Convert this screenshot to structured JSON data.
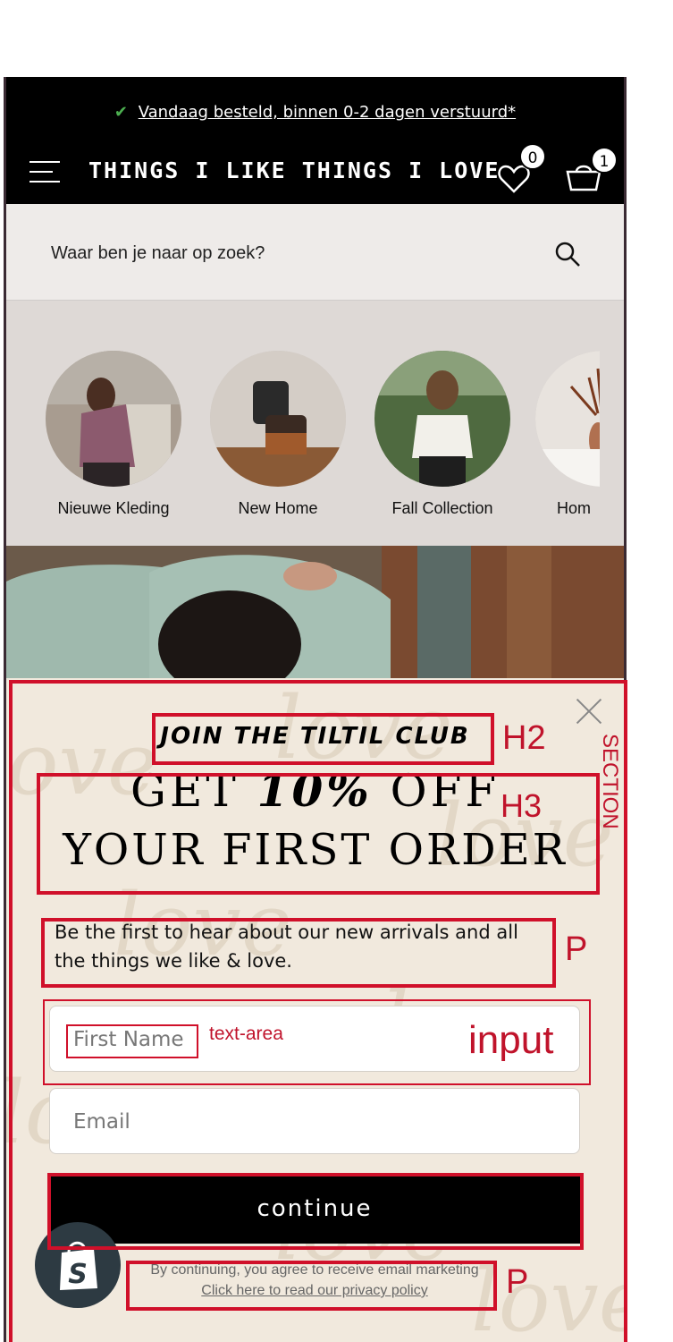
{
  "announcement": {
    "check": "✔",
    "text": "Vandaag besteld, binnen 0-2 dagen verstuurd*"
  },
  "header": {
    "logo": "THINGS I LIKE THINGS I LOVE",
    "wishlist_count": "0",
    "cart_count": "1"
  },
  "search": {
    "placeholder": "Waar ben je naar op zoek?"
  },
  "categories": [
    {
      "label": "Nieuwe Kleding"
    },
    {
      "label": "New Home"
    },
    {
      "label": "Fall Collection"
    },
    {
      "label": "Hom"
    }
  ],
  "popup": {
    "h2": "JOIN THE TILTIL CLUB",
    "h3_line1_prefix": "GET",
    "h3_line1_highlight": "10%",
    "h3_line1_suffix": "OFF",
    "h3_line2": "YOUR FIRST ORDER",
    "description": "Be the first to hear about our new arrivals and all the things we like & love.",
    "first_name_placeholder": "First Name",
    "email_placeholder": "Email",
    "cta": "continue",
    "legal_line1": "By continuing, you agree to receive email marketing",
    "legal_line2": "Click here to read our privacy policy",
    "watermark": "love"
  },
  "annotations": {
    "section": "SECTION",
    "h2": "H2",
    "h3": "H3",
    "p1": "P",
    "input": "input",
    "text_area": "text-area",
    "p2": "P"
  },
  "colors": {
    "annotation": "#d0102a",
    "popup_bg": "#f1e9dd",
    "cta_bg": "#000000"
  }
}
